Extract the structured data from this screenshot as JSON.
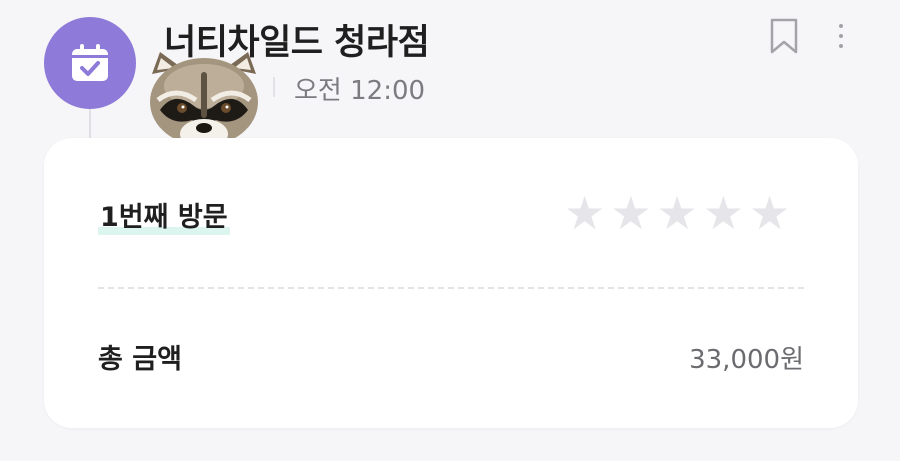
{
  "header": {
    "icon": "calendar-check-icon",
    "title": "너티차일드 청라점",
    "time": "오전 12:00",
    "bookmark_icon": "bookmark-icon",
    "more_icon": "more-vertical-icon",
    "accent_color": "#8e7ad8"
  },
  "card": {
    "visit_label": "1번째 방문",
    "rating": {
      "value": 0,
      "max": 5
    },
    "star_symbols": [
      "★",
      "★",
      "★",
      "★",
      "★"
    ],
    "total_label": "총 금액",
    "total_amount": "33,000원"
  }
}
